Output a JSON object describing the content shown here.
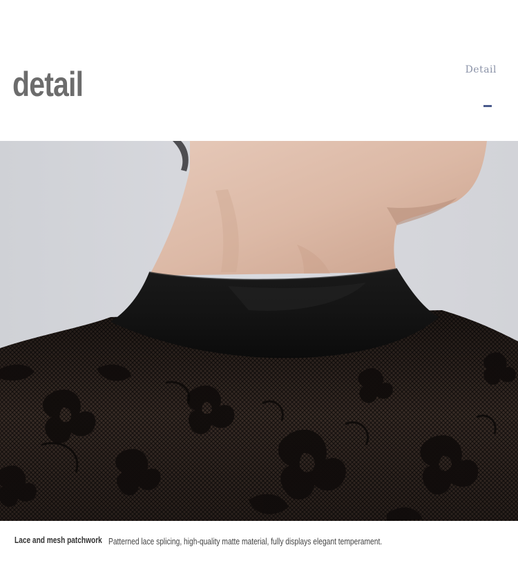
{
  "header": {
    "title": "detail",
    "subtitle": "Detail"
  },
  "photo": {
    "subject": "neck-lace-collar-closeup"
  },
  "caption": {
    "highlight": "Lace and mesh patchwork",
    "text": "Patterned lace splicing, high-quality matte material, fully displays elegant temperament."
  },
  "colors": {
    "title": "#6c6c6c",
    "subtitle": "#8b93a8",
    "accent_dash": "#4a5a8c",
    "background": "#ffffff"
  }
}
